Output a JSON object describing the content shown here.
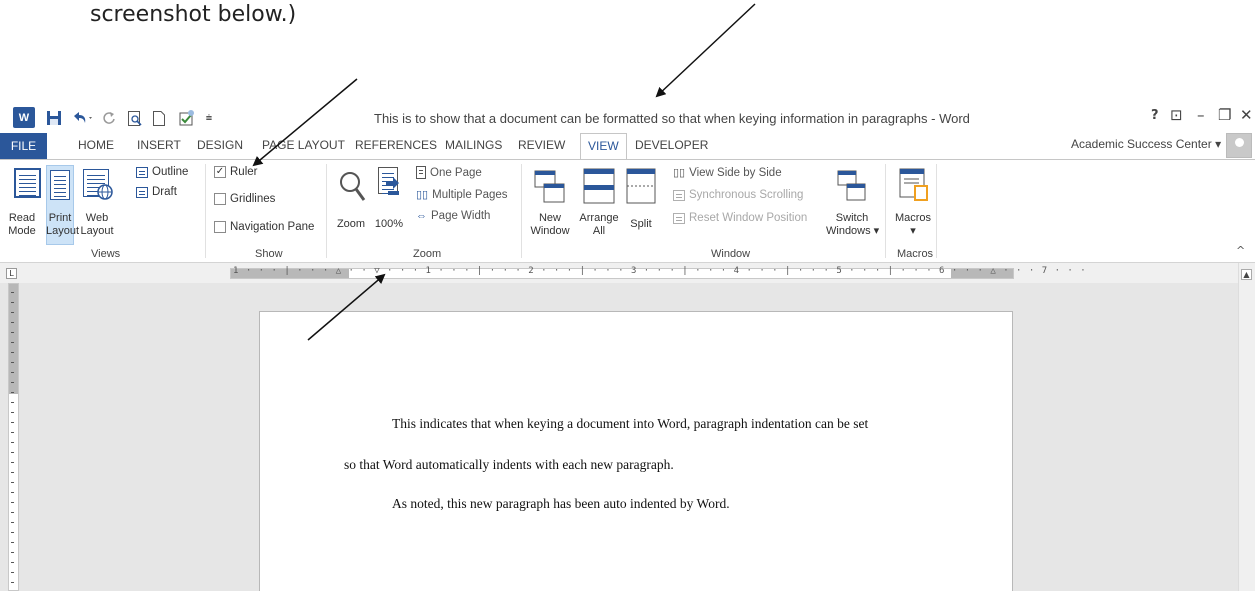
{
  "caption": "screenshot below.)",
  "title_bar": {
    "app_icon": "W",
    "doc_title": "This is to show that a document can be formatted so that when keying information in paragraphs - Word",
    "quick_access": [
      "save-icon",
      "undo-icon",
      "redo-icon",
      "print-preview-icon",
      "new-document-icon",
      "spelling-icon",
      "customize-icon"
    ],
    "controls": [
      "?",
      "⊡",
      "–",
      "❐",
      "✕"
    ]
  },
  "tabs": [
    "FILE",
    "HOME",
    "INSERT",
    "DESIGN",
    "PAGE LAYOUT",
    "REFERENCES",
    "MAILINGS",
    "REVIEW",
    "VIEW",
    "DEVELOPER"
  ],
  "active_tab": "VIEW",
  "account": "Academic Success Center",
  "account_chevron": "▾",
  "ribbon": {
    "views": {
      "label": "Views",
      "read_mode": [
        "Read",
        "Mode"
      ],
      "print_layout": [
        "Print",
        "Layout"
      ],
      "web_layout": [
        "Web",
        "Layout"
      ],
      "outline": "Outline",
      "draft": "Draft"
    },
    "show": {
      "label": "Show",
      "ruler": "Ruler",
      "ruler_checked": "✓",
      "gridlines": "Gridlines",
      "navigation_pane": "Navigation Pane"
    },
    "zoom": {
      "label": "Zoom",
      "zoom": "Zoom",
      "hundred": "100%",
      "one_page": "One Page",
      "multiple_pages": "Multiple Pages",
      "page_width": "Page Width"
    },
    "window": {
      "label": "Window",
      "new_window": [
        "New",
        "Window"
      ],
      "arrange_all": [
        "Arrange",
        "All"
      ],
      "split": "Split",
      "view_side_by_side": "View Side by Side",
      "sync_scrolling": "Synchronous Scrolling",
      "reset_window": "Reset Window Position",
      "switch_windows": [
        "Switch",
        "Windows ▾"
      ]
    },
    "macros": {
      "label": "Macros",
      "macros": [
        "Macros",
        "▾"
      ]
    }
  },
  "ruler": {
    "tab_selector": "L",
    "marks": "1 · · · | · · · △ · · ▽ · · · 1 · · · | · · · 2 · · · | · · · 3 · · · | · · · 4 · · · | · · · 5 · · · | · · · 6 · · · △ · · · 7 · · ·"
  },
  "document": {
    "lines": [
      "This indicates that when keying a document into Word, paragraph indentation can be set",
      "so that Word automatically indents with each new paragraph.",
      "As noted, this new paragraph has been auto indented by Word."
    ]
  },
  "scroll_up": "▲",
  "collapse_ribbon": "^"
}
